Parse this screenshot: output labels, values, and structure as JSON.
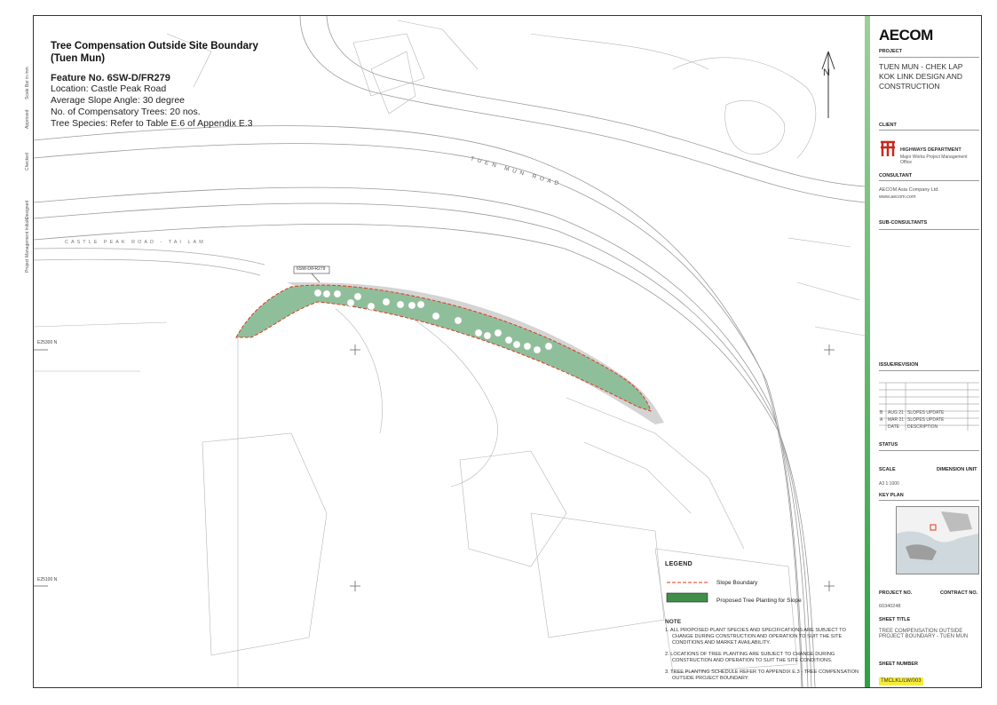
{
  "title": {
    "heading": "Tree Compensation Outside Site Boundary (Tuen Mun)",
    "feature": "Feature No. 6SW-D/FR279",
    "location": "Location: Castle Peak Road",
    "slope_angle": "Average Slope Angle: 30 degree",
    "trees": "No. of Compensatory Trees: 20 nos.",
    "species": "Tree Species: Refer to Table E.6 of Appendix E.3"
  },
  "map_labels": {
    "tuen_mun_road": "TUEN MUN ROAD",
    "castle_peak_road": "CASTLE PEAK ROAD - TAI LAM",
    "feature_tag": "6SW-D/FR279",
    "north": "N",
    "grid_e1": "E25300 N",
    "grid_e2": "E25100 N"
  },
  "legend": {
    "heading": "LEGEND",
    "slope_boundary": "Slope Boundary",
    "planting": "Proposed Tree Planting for Slope"
  },
  "notes": {
    "heading": "NOTE",
    "items": [
      "1. ALL PROPOSED PLANT SPECIES AND SPECIFICATIONS ARE SUBJECT TO CHANGE DURING CONSTRUCTION AND OPERATION TO SUIT THE SITE CONDITIONS AND MARKET AVAILABILITY.",
      "2. LOCATIONS OF TREE PLANTING ARE SUBJECT TO CHANGE DURING CONSTRUCTION AND OPERATION TO SUIT THE SITE CONDITIONS.",
      "3. TREE PLANTING SCHEDULE REFER TO APPENDIX E.3 - TREE COMPENSATION OUTSIDE PROJECT BOUNDARY."
    ]
  },
  "side_strip": {
    "scale_bar": "Scale Bar in mm",
    "approved": "Approved",
    "checked": "Checked",
    "designed": "Designed",
    "pm": "Project Management Initials"
  },
  "panel": {
    "logo": "AECOM",
    "project_label": "PROJECT",
    "project_name": "TUEN MUN - CHEK LAP KOK LINK DESIGN AND CONSTRUCTION",
    "client_label": "CLIENT",
    "client_name": "HIGHWAYS DEPARTMENT",
    "client_office": "Major Works Project Management Office",
    "consultant_label": "CONSULTANT",
    "consultant_name": "AECOM Asia Company Ltd.",
    "consultant_web": "www.aecom.com",
    "subconsultants_label": "SUB-CONSULTANTS",
    "issue_label": "ISSUE/REVISION",
    "rev_b": "B",
    "rev_b_date": "AUG 21",
    "rev_b_desc": "SLOPES UPDATE",
    "rev_a": "A",
    "rev_a_date": "MAR 21",
    "rev_a_desc": "SLOPES UPDATE",
    "rev_hdr_date": "DATE",
    "rev_hdr_desc": "DESCRIPTION",
    "status_label": "STATUS",
    "scale_label": "SCALE",
    "dimension_label": "DIMENSION UNIT",
    "scale_value": "A3 1:1000",
    "keyplan_label": "KEY PLAN",
    "project_no_label": "PROJECT NO.",
    "contract_no_label": "CONTRACT NO.",
    "project_no": "60340248",
    "sheet_title_label": "SHEET TITLE",
    "sheet_title": "TREE COMPENSATION OUTSIDE PROJECT BOUNDARY - TUEN MUN",
    "sheet_number_label": "SHEET NUMBER",
    "sheet_number": "TMCLKL/LW/003"
  },
  "colors": {
    "green_bar": "#2ea043",
    "slope_fill": "#8fbf9a",
    "boundary": "#e03a1e",
    "sheet_highlight": "#f6ec3c"
  }
}
